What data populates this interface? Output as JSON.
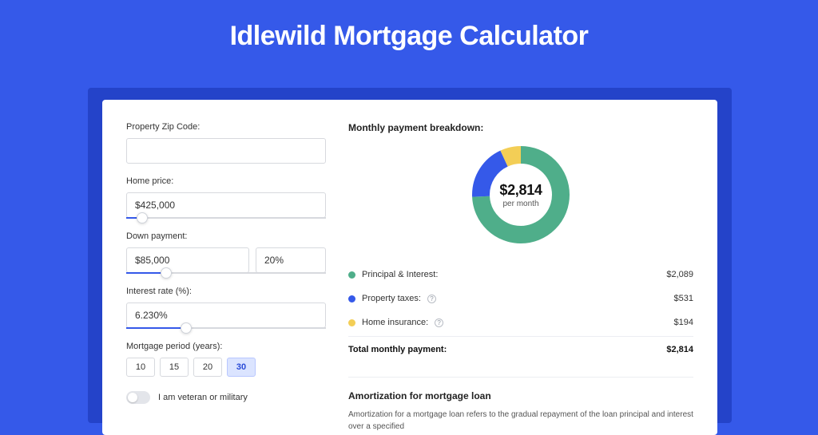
{
  "title": "Idlewild Mortgage Calculator",
  "form": {
    "zip": {
      "label": "Property Zip Code:",
      "value": ""
    },
    "home_price": {
      "label": "Home price:",
      "value": "$425,000",
      "slider_pct": 8
    },
    "down_payment": {
      "label": "Down payment:",
      "value": "$85,000",
      "pct": "20%",
      "slider_pct": 20
    },
    "interest": {
      "label": "Interest rate (%):",
      "value": "6.230%",
      "slider_pct": 30
    },
    "period": {
      "label": "Mortgage period (years):",
      "options": [
        "10",
        "15",
        "20",
        "30"
      ],
      "selected": "30"
    },
    "veteran": {
      "label": "I am veteran or military",
      "value": false
    }
  },
  "breakdown": {
    "title": "Monthly payment breakdown:",
    "center_amount": "$2,814",
    "center_sub": "per month",
    "items": [
      {
        "label": "Principal & Interest:",
        "value": "$2,089",
        "color": "#4fae8a",
        "info": false
      },
      {
        "label": "Property taxes:",
        "value": "$531",
        "color": "#3559e9",
        "info": true
      },
      {
        "label": "Home insurance:",
        "value": "$194",
        "color": "#f3ce56",
        "info": true
      }
    ],
    "total_label": "Total monthly payment:",
    "total_value": "$2,814"
  },
  "chart_data": {
    "type": "pie",
    "title": "Monthly payment breakdown",
    "series": [
      {
        "name": "Principal & Interest",
        "value": 2089,
        "color": "#4fae8a"
      },
      {
        "name": "Property taxes",
        "value": 531,
        "color": "#3559e9"
      },
      {
        "name": "Home insurance",
        "value": 194,
        "color": "#f3ce56"
      }
    ],
    "total": 2814,
    "center_label": "$2,814 per month"
  },
  "amortization": {
    "title": "Amortization for mortgage loan",
    "text": "Amortization for a mortgage loan refers to the gradual repayment of the loan principal and interest over a specified"
  }
}
